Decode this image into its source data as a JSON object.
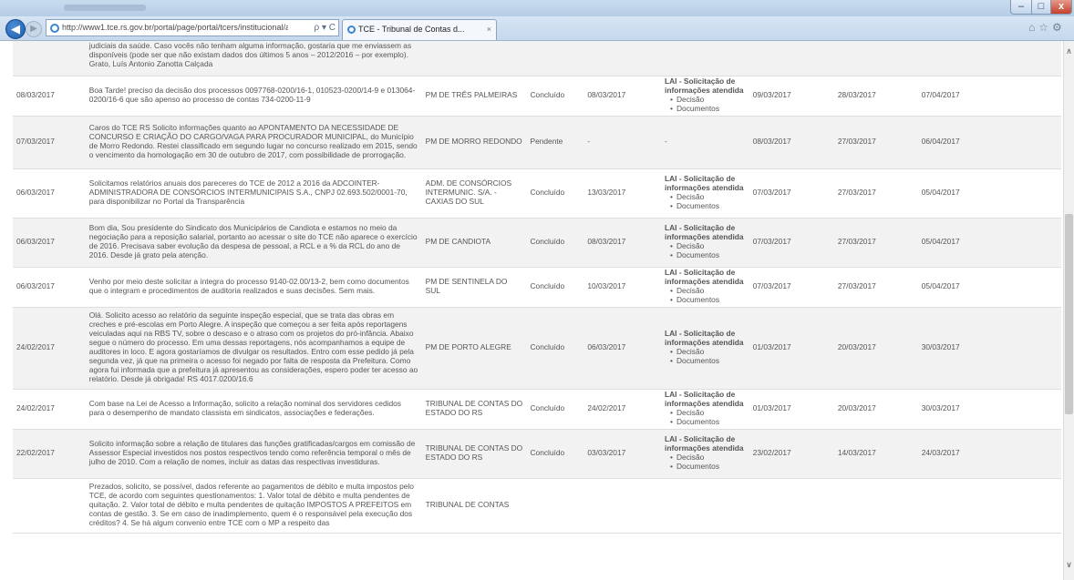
{
  "browser": {
    "address_url": "http://www1.tce.rs.gov.br/portal/page/portal/tcers/institucional/acc",
    "address_controls": "ρ ▾ C",
    "tab_title": "TCE - Tribunal de Contas d...",
    "tab_close": "×",
    "back": "◀",
    "forward": "▶",
    "min": "–",
    "max": "□",
    "close": "x",
    "tools": "⌂☆⚙",
    "scroll_up": "∧",
    "scroll_down": "∨"
  },
  "lai": {
    "title": "LAI - Solicitação de informações atendida",
    "item1": "Decisão",
    "item2": "Documentos"
  },
  "rows": [
    {
      "date": "",
      "message": "judiciais da saúde. Caso vocês não tenham alguma informação, gostaria que me enviassem as disponíveis (pode ser que não existam dados dos últimos 5 anos – 2012/2016 – por exemplo). Grato, Luís Antonio Zanotta Calçada",
      "org": "",
      "status": "",
      "date2": "",
      "d3": "",
      "d4": "",
      "d5": ""
    },
    {
      "date": "08/03/2017",
      "message": "Boa Tarde! preciso da decisão dos processos 0097768-0200/16-1, 010523-0200/14-9 e 013064-0200/16-6 que são apenso ao processo de contas 734-0200-11-9",
      "org": "PM DE TRÊS PALMEIRAS",
      "status": "Concluído",
      "date2": "08/03/2017",
      "d3": "09/03/2017",
      "d4": "28/03/2017",
      "d5": "07/04/2017"
    },
    {
      "date": "07/03/2017",
      "message": "Caros do TCE RS Solicito informações quanto ao APONTAMENTO DA NECESSIDADE DE CONCURSO E CRIAÇÃO DO CARGO/VAGA PARA PROCURADOR MUNICIPAL, do Município de Morro Redondo. Restei classificado em segundo lugar no concurso realizado em 2015, sendo o vencimento da homologação em 30 de outubro de 2017, com possibilidade de prorrogação.",
      "org": "PM DE MORRO REDONDO",
      "status": "Pendente",
      "date2": "-",
      "lai_dash": "-",
      "d3": "08/03/2017",
      "d4": "27/03/2017",
      "d5": "06/04/2017"
    },
    {
      "date": "06/03/2017",
      "message": "Solicitamos relatórios anuais dos pareceres do TCE de 2012 a 2016 da ADCOINTER- ADMINISTRADORA DE CONSÓRCIOS INTERMUNICIPAIS S.A., CNPJ 02.693.502/0001-70, para disponibilizar no Portal da Transparência",
      "org": "ADM. DE CONSÓRCIOS INTERMUNIC. S/A. - CAXIAS DO SUL",
      "status": "Concluído",
      "date2": "13/03/2017",
      "d3": "07/03/2017",
      "d4": "27/03/2017",
      "d5": "05/04/2017"
    },
    {
      "date": "06/03/2017",
      "message": "Bom dia, Sou presidente do Sindicato dos Municipários de Candiota e estamos no meio da negociação para a reposição salarial, portanto ao acessar o site do TCE não aparece o exercício de 2016. Precisava saber evolução da despesa de pessoal, a RCL e a % da RCL do ano de 2016. Desde já grato pela atenção.",
      "org": "PM DE CANDIOTA",
      "status": "Concluído",
      "date2": "08/03/2017",
      "d3": "07/03/2017",
      "d4": "27/03/2017",
      "d5": "05/04/2017"
    },
    {
      "date": "06/03/2017",
      "message": "Venho por meio deste solicitar a íntegra do processo 9140-02.00/13-2, bem como documentos que o integram e procedimentos de auditoria realizados e suas decisões. Sem mais.",
      "org": "PM DE SENTINELA DO SUL",
      "status": "Concluído",
      "date2": "10/03/2017",
      "d3": "07/03/2017",
      "d4": "27/03/2017",
      "d5": "05/04/2017"
    },
    {
      "date": "24/02/2017",
      "message": "Olá. Solicito acesso ao relatório da seguinte inspeção especial, que se trata das obras em creches e pré-escolas em Porto Alegre. A inspeção que começou a ser feita após reportagens veiculadas aqui na RBS TV, sobre o descaso e o atraso com os projetos do pró-infância. Abaixo segue o número do processo. Em uma dessas reportagens, nós acompanhamos a equipe de auditores in loco. E agora gostaríamos de divulgar os resultados. Entro com esse pedido já pela segunda vez, já que na primeira o acesso foi negado por falta de resposta da Prefeitura. Como agora fui informada que a prefeitura já apresentou as considerações, espero poder ter acesso ao relatório. Desde já obrigada! RS 4017.0200/16.6",
      "org": "PM DE PORTO ALEGRE",
      "status": "Concluído",
      "date2": "06/03/2017",
      "d3": "01/03/2017",
      "d4": "20/03/2017",
      "d5": "30/03/2017"
    },
    {
      "date": "24/02/2017",
      "message": "Com base na Lei de Acesso a Informação, solicito a relação nominal dos servidores cedidos para o desempenho de mandato classista em sindicatos, associações e federações.",
      "org": "TRIBUNAL DE CONTAS DO ESTADO DO RS",
      "status": "Concluído",
      "date2": "24/02/2017",
      "d3": "01/03/2017",
      "d4": "20/03/2017",
      "d5": "30/03/2017"
    },
    {
      "date": "22/02/2017",
      "message": "Solicito informação sobre a relação de titulares das funções gratificadas/cargos em comissão de Assessor Especial investidos nos postos respectivos tendo como referência temporal o mês de julho de 2010. Com a relação de nomes, incluir as datas das respectivas investiduras.",
      "org": "TRIBUNAL DE CONTAS DO ESTADO DO RS",
      "status": "Concluído",
      "date2": "03/03/2017",
      "d3": "23/02/2017",
      "d4": "14/03/2017",
      "d5": "24/03/2017"
    },
    {
      "date": "",
      "message": "Prezados, solicito, se possível, dados referente ao pagamentos de débito e multa impostos pelo TCE, de acordo com seguintes questionamentos: 1. Valor total de débito e multa pendentes de quitação. 2. Valor total de débito e multa pendentes de quitação IMPOSTOS A PREFEITOS em contas de gestão. 3. Se em caso de inadimplemento, quem é o responsável pela execução dos créditos? 4. Se há algum convenio entre TCE com o MP a respeito das",
      "org": "TRIBUNAL DE CONTAS",
      "status": "",
      "date2": "",
      "d3": "",
      "d4": "",
      "d5": ""
    }
  ]
}
